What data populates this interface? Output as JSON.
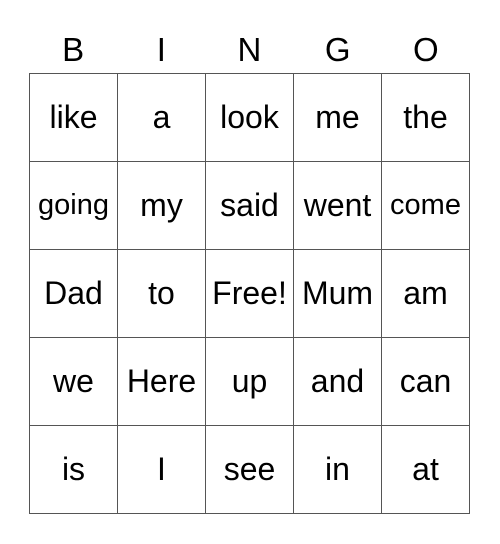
{
  "header": [
    "B",
    "I",
    "N",
    "G",
    "O"
  ],
  "rows": [
    [
      "like",
      "a",
      "look",
      "me",
      "the"
    ],
    [
      "going",
      "my",
      "said",
      "went",
      "come"
    ],
    [
      "Dad",
      "to",
      "Free!",
      "Mum",
      "am"
    ],
    [
      "we",
      "Here",
      "up",
      "and",
      "can"
    ],
    [
      "is",
      "I",
      "see",
      "in",
      "at"
    ]
  ]
}
